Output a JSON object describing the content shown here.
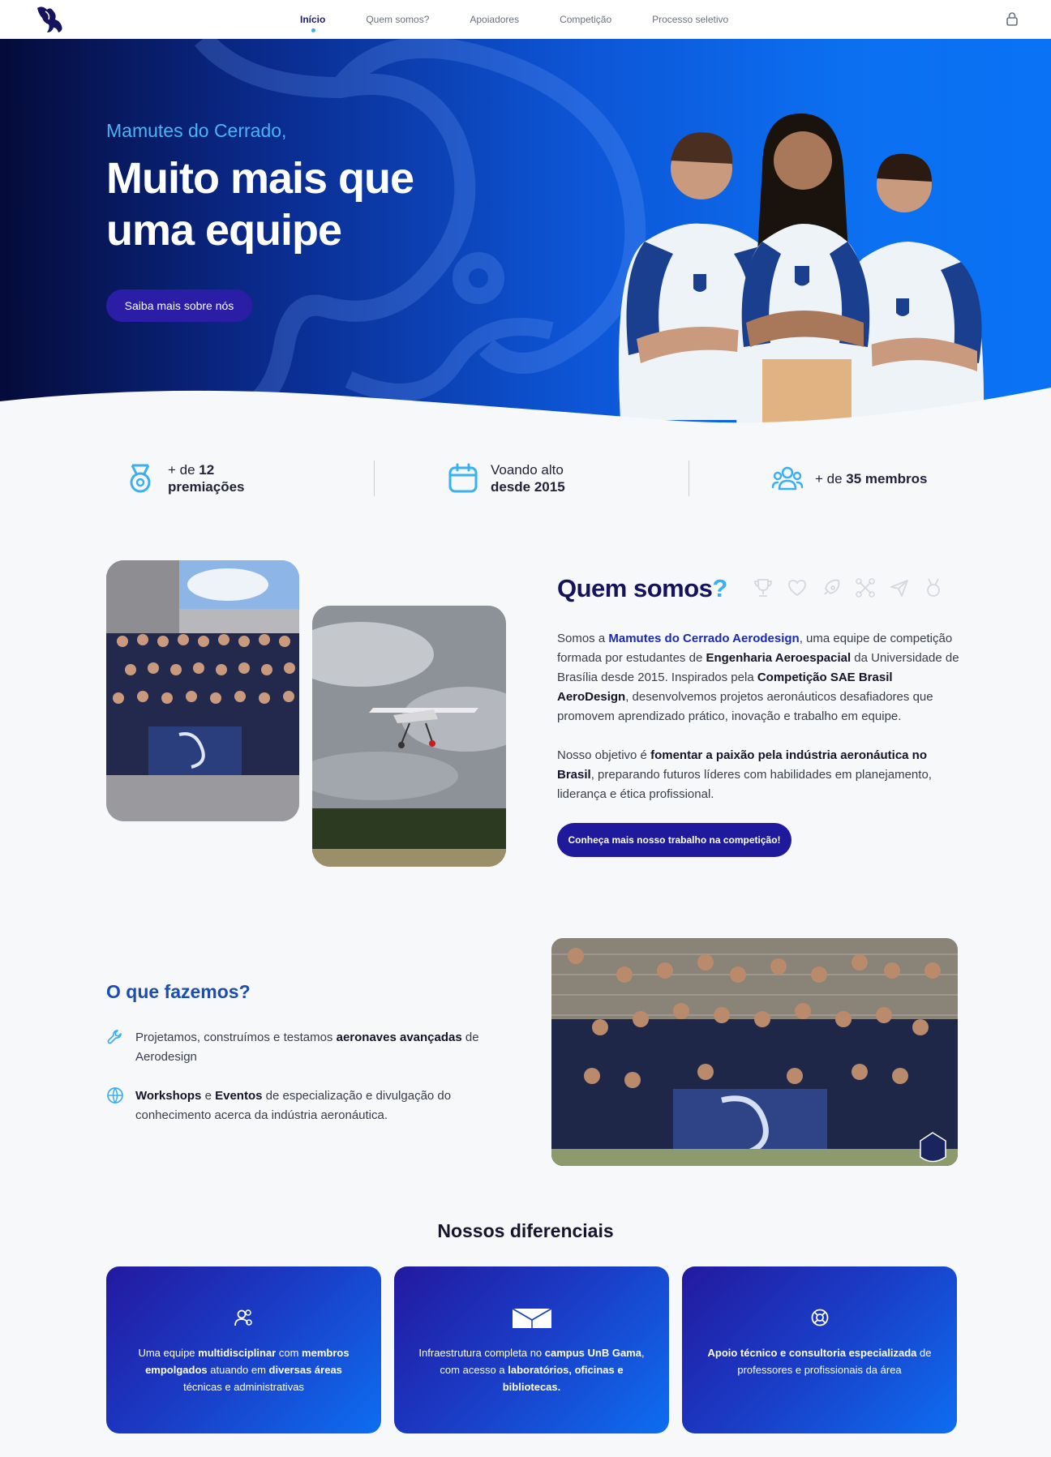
{
  "nav": {
    "links": [
      "Início",
      "Quem somos?",
      "Apoiadores",
      "Competição",
      "Processo seletivo"
    ],
    "active_index": 0,
    "icons": {
      "logo": "mammoth-logo",
      "lock": "lock-icon"
    }
  },
  "hero": {
    "eyebrow": "Mamutes do Cerrado,",
    "title": "Muito mais que uma equipe",
    "button": "Saiba mais sobre nós"
  },
  "stats": [
    {
      "icon": "medal-icon",
      "prefix": "+ de ",
      "strong": "12",
      "line2": "premiações"
    },
    {
      "icon": "calendar-icon",
      "prefix": "Voando alto",
      "strong": "",
      "line2": "desde 2015"
    },
    {
      "icon": "users-icon",
      "prefix": "+ de ",
      "strong": "35 membros",
      "line2": ""
    }
  ],
  "quem_somos": {
    "title": "Quem somos",
    "title_mark": "?",
    "decor_icons": [
      "trophy-icon",
      "heart-icon",
      "rocket-icon",
      "drone-icon",
      "send-icon",
      "medal-icon"
    ],
    "p1": {
      "t1": "Somos a ",
      "h1": "Mamutes do Cerrado Aerodesign",
      "t2": ", uma equipe de competição formada por estudantes de ",
      "b1": "Engenharia Aeroespacial",
      "t3": " da Universidade de Brasília desde 2015. Inspirados pela ",
      "b2": "Competição SAE Brasil AeroDesign",
      "t4": ", desenvolvemos projetos aeronáuticos desafiadores que promovem aprendizado prático, inovação e trabalho em equipe."
    },
    "p2": {
      "t1": "Nosso objetivo é ",
      "b1": "fomentar a paixão pela indústria aeronáutica no Brasil",
      "t2": ", preparando futuros líderes com habilidades em planejamento, liderança e ética profissional."
    },
    "button": "Conheça mais nosso trabalho na competição!"
  },
  "o_que_fazemos": {
    "title": "O que fazemos?",
    "item1": {
      "icon": "wrench-icon",
      "t1": "Projetamos, construímos e testamos ",
      "b1": "aeronaves avançadas",
      "t2": " de Aerodesign"
    },
    "item2": {
      "icon": "globe-icon",
      "b1": "Workshops",
      "t1": " e ",
      "b2": "Eventos",
      "t2": " de especialização e divulgação do conhecimento acerca da indústria aeronáutica."
    }
  },
  "diferenciais": {
    "title": "Nossos diferenciais",
    "cards": [
      {
        "icon": "team-icon",
        "t1": "Uma equipe ",
        "b1": "multidisciplinar",
        "t2": " com ",
        "b2": "membros empolgados",
        "t3": " atuando em ",
        "b3": "diversas áreas",
        "t4": " técnicas e administrativas"
      },
      {
        "icon": "envelope-book-icon",
        "t1": "Infraestrutura completa no ",
        "b1": "campus UnB Gama",
        "t2": ", com acesso a ",
        "b2": "laboratórios, oficinas e bibliotecas.",
        "t3": "",
        "b3": "",
        "t4": ""
      },
      {
        "icon": "lifebuoy-icon",
        "t1": "",
        "b1": "Apoio técnico e consultoria especializada",
        "t2": " de professores e profissionais da área",
        "b2": "",
        "t3": "",
        "b3": "",
        "t4": ""
      }
    ]
  },
  "colors": {
    "navy": "#15135e",
    "accent": "#3ab0f0",
    "button": "#1e1a9b",
    "hero_start": "#050b3a",
    "hero_end": "#0a72f5"
  }
}
